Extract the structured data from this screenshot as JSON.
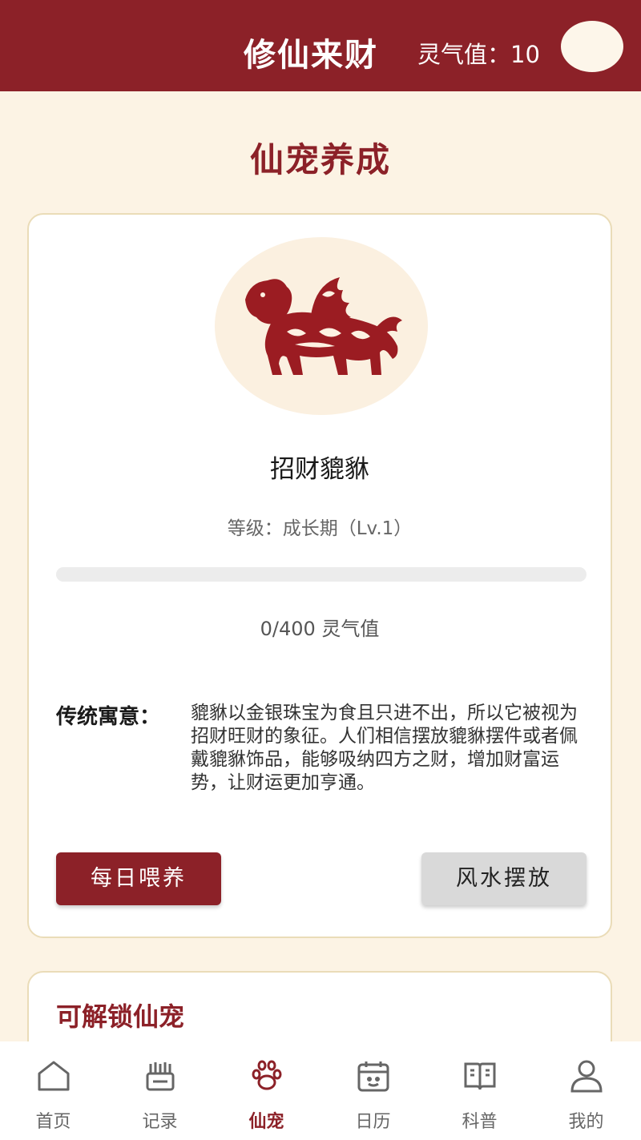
{
  "header": {
    "app_title": "修仙来财",
    "qi_label": "灵气值：10"
  },
  "page": {
    "title": "仙宠养成"
  },
  "pet": {
    "name": "招财貔貅",
    "level_text": "等级：成长期（Lv.1）",
    "progress_fraction": 0,
    "progress_text": "0/400 灵气值",
    "meaning_label": "传统寓意：",
    "meaning_text": "貔貅以金银珠宝为食且只进不出，所以它被视为招财旺财的象征。人们相信摆放貔貅摆件或者佩戴貔貅饰品，能够吸纳四方之财，增加财富运势，让财运更加亨通。",
    "feed_button": "每日喂养",
    "fengshui_button": "风水摆放"
  },
  "unlock": {
    "title": "可解锁仙宠"
  },
  "tabs": [
    {
      "label": "首页",
      "icon": "home-icon"
    },
    {
      "label": "记录",
      "icon": "record-icon"
    },
    {
      "label": "仙宠",
      "icon": "paw-icon"
    },
    {
      "label": "日历",
      "icon": "calendar-icon"
    },
    {
      "label": "科普",
      "icon": "book-icon"
    },
    {
      "label": "我的",
      "icon": "user-icon"
    }
  ],
  "colors": {
    "primary": "#8c2128",
    "background": "#fcf3e4"
  }
}
